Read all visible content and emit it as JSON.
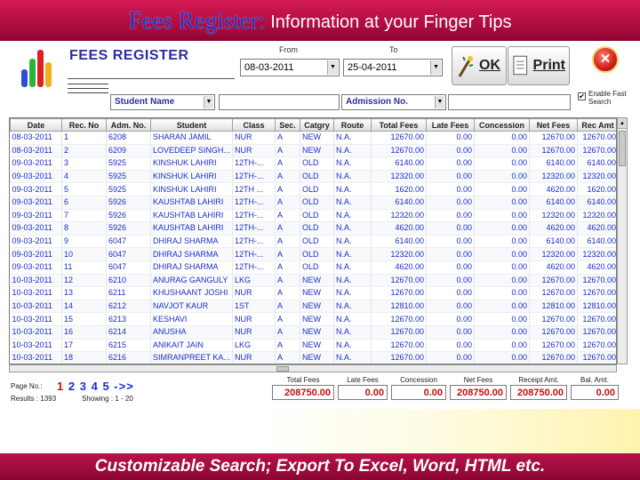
{
  "banner": {
    "title": "Fees Register:",
    "subtitle": "Information at your Finger Tips"
  },
  "app": {
    "title": "FEES REGISTER",
    "from_label": "From",
    "to_label": "To",
    "from_date": "08-03-2011",
    "to_date": "25-04-2011",
    "ok_label": "OK",
    "print_label": "Print",
    "close_icon": "close-icon",
    "filter1": "Student Name",
    "filter2": "Admission No.",
    "enable_fast_search": "Enable Fast Search",
    "enable_fast_search_checked": true
  },
  "grid": {
    "headers": [
      "Date",
      "Rec. No",
      "Adm. No.",
      "Student",
      "Class",
      "Sec.",
      "Catgry",
      "Route",
      "Total Fees",
      "Late Fees",
      "Concession",
      "Net Fees",
      "Rec Amt"
    ],
    "rows": [
      [
        "08-03-2011",
        "1",
        "6208",
        "SHARAN JAMIL",
        "NUR",
        "A",
        "NEW",
        "N.A.",
        "12670.00",
        "0.00",
        "0.00",
        "12670.00",
        "12670.00"
      ],
      [
        "08-03-2011",
        "2",
        "6209",
        "LOVEDEEP SINGH...",
        "NUR",
        "A",
        "NEW",
        "N.A.",
        "12670.00",
        "0.00",
        "0.00",
        "12670.00",
        "12670.00"
      ],
      [
        "09-03-2011",
        "3",
        "5925",
        "KINSHUK LAHIRI",
        "12TH-...",
        "A",
        "OLD",
        "N.A.",
        "6140.00",
        "0.00",
        "0.00",
        "6140.00",
        "6140.00"
      ],
      [
        "09-03-2011",
        "4",
        "5925",
        "KINSHUK LAHIRI",
        "12TH-...",
        "A",
        "OLD",
        "N.A.",
        "12320.00",
        "0.00",
        "0.00",
        "12320.00",
        "12320.00"
      ],
      [
        "09-03-2011",
        "5",
        "5925",
        "KINSHUK LAHIRI",
        "12TH ...",
        "A",
        "OLD",
        "N.A.",
        "1620.00",
        "0.00",
        "0.00",
        "4620.00",
        "1620.00"
      ],
      [
        "09-03-2011",
        "6",
        "5926",
        "KAUSHTAB LAHIRI",
        "12TH-...",
        "A",
        "OLD",
        "N.A.",
        "6140.00",
        "0.00",
        "0.00",
        "6140.00",
        "6140.00"
      ],
      [
        "09-03-2011",
        "7",
        "5926",
        "KAUSHTAB LAHIRI",
        "12TH-...",
        "A",
        "OLD",
        "N.A.",
        "12320.00",
        "0.00",
        "0.00",
        "12320.00",
        "12320.00"
      ],
      [
        "09-03-2011",
        "8",
        "5926",
        "KAUSHTAB LAHIRI",
        "12TH-...",
        "A",
        "OLD",
        "N.A.",
        "4620.00",
        "0.00",
        "0.00",
        "4620.00",
        "4620.00"
      ],
      [
        "09-03-2011",
        "9",
        "6047",
        "DHIRAJ SHARMA",
        "12TH-...",
        "A",
        "OLD",
        "N.A.",
        "6140.00",
        "0.00",
        "0.00",
        "6140.00",
        "6140.00"
      ],
      [
        "09-03-2011",
        "10",
        "6047",
        "DHIRAJ SHARMA",
        "12TH-...",
        "A",
        "OLD",
        "N.A.",
        "12320.00",
        "0.00",
        "0.00",
        "12320.00",
        "12320.00"
      ],
      [
        "09-03-2011",
        "11",
        "6047",
        "DHIRAJ SHARMA",
        "12TH-...",
        "A",
        "OLD",
        "N.A.",
        "4620.00",
        "0.00",
        "0.00",
        "4620.00",
        "4620.00"
      ],
      [
        "10-03-2011",
        "12",
        "6210",
        "ANURAG GANGULY",
        "LKG",
        "A",
        "NEW",
        "N.A.",
        "12670.00",
        "0.00",
        "0.00",
        "12670.00",
        "12670.00"
      ],
      [
        "10-03-2011",
        "13",
        "6211",
        "KHUSHAANT JOSHI",
        "NUR",
        "A",
        "NEW",
        "N.A.",
        "12670.00",
        "0.00",
        "0.00",
        "12670.00",
        "12670.00"
      ],
      [
        "10-03-2011",
        "14",
        "6212",
        "NAVJOT KAUR",
        "1ST",
        "A",
        "NEW",
        "N.A.",
        "12810.00",
        "0.00",
        "0.00",
        "12810.00",
        "12810.00"
      ],
      [
        "10-03-2011",
        "15",
        "6213",
        "KESHAVI",
        "NUR",
        "A",
        "NEW",
        "N.A.",
        "12670.00",
        "0.00",
        "0.00",
        "12670.00",
        "12670.00"
      ],
      [
        "10-03-2011",
        "16",
        "6214",
        "ANUSHA",
        "NUR",
        "A",
        "NEW",
        "N.A.",
        "12670.00",
        "0.00",
        "0.00",
        "12670.00",
        "12670.00"
      ],
      [
        "10-03-2011",
        "17",
        "6215",
        "ANIKAIT JAIN",
        "LKG",
        "A",
        "NEW",
        "N.A.",
        "12670.00",
        "0.00",
        "0.00",
        "12670.00",
        "12670.00"
      ],
      [
        "10-03-2011",
        "18",
        "6216",
        "SIMRANPREET KA...",
        "NUR",
        "A",
        "NEW",
        "N.A.",
        "12670.00",
        "0.00",
        "0.00",
        "12670.00",
        "12670.00"
      ]
    ]
  },
  "footer": {
    "page_label": "Page No.:",
    "pages": [
      "1",
      "2",
      "3",
      "4",
      "5",
      "->>"
    ],
    "results_label": "Results :",
    "results_value": "1393",
    "showing_label": "Showing :",
    "showing_value": "1 - 20",
    "totals": [
      {
        "label": "Total Fees",
        "value": "208750.00"
      },
      {
        "label": "Late Fees",
        "value": "0.00"
      },
      {
        "label": "Concession",
        "value": "0.00"
      },
      {
        "label": "Net Fees",
        "value": "208750.00"
      },
      {
        "label": "Receipt Amt.",
        "value": "208750.00"
      },
      {
        "label": "Bal. Amt.",
        "value": "0.00"
      }
    ]
  },
  "bottom_banner": "Customizable Search; Export To Excel, Word, HTML etc.",
  "colors": {
    "banner": "#b8124a",
    "grid_text": "#1a2ec8",
    "total_text": "#c01010"
  }
}
